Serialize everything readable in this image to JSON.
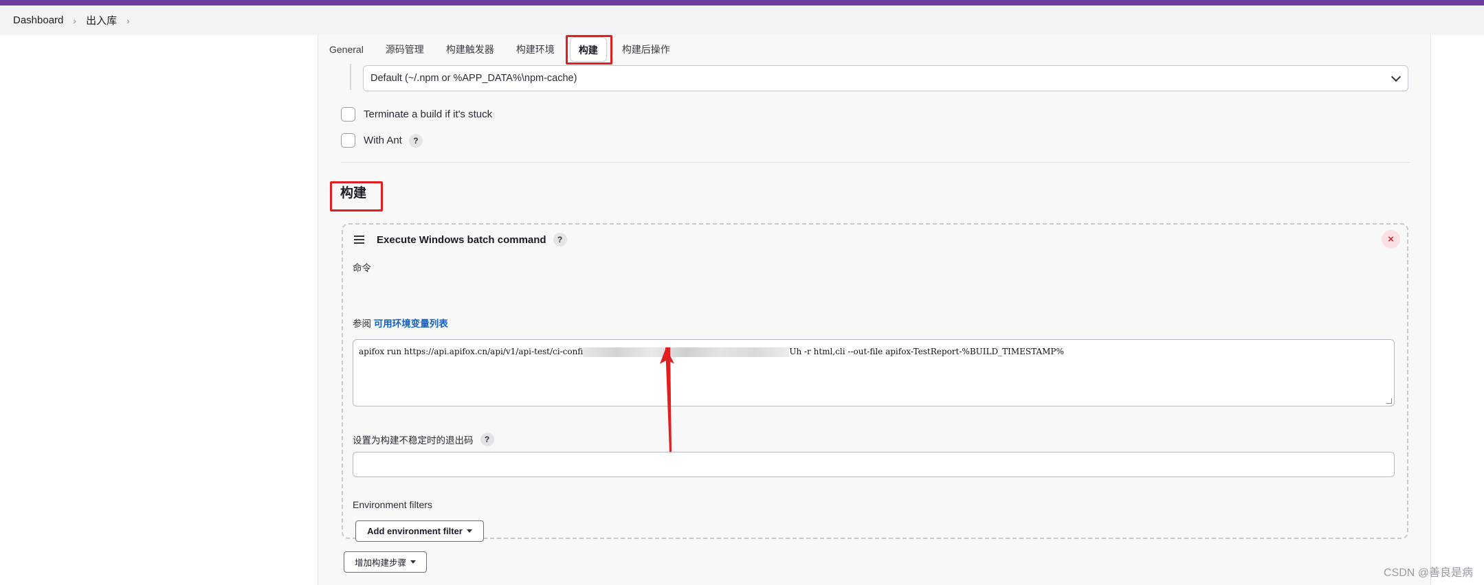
{
  "breadcrumb": {
    "items": [
      "Dashboard",
      "出入库"
    ]
  },
  "tabs": [
    "General",
    "源码管理",
    "构建触发器",
    "构建环境",
    "构建",
    "构建后操作"
  ],
  "active_tab": "构建",
  "npm_cache_select": {
    "value": "Default (~/.npm or %APP_DATA%\\npm-cache)"
  },
  "checkboxes": {
    "terminate_label": "Terminate a build if it's stuck",
    "with_ant_label": "With Ant"
  },
  "section": {
    "title": "构建"
  },
  "build_step": {
    "title": "Execute Windows batch command",
    "help": "?",
    "close": "×",
    "command_label": "命令",
    "see_also_prefix": "参阅",
    "see_also_link": "可用环境变量列表",
    "command_start": "apifox run https://api.apifox.cn/api/v1/api-test/ci-confi",
    "command_end": "Uh -r html,cli --out-file apifox-TestReport-%BUILD_TIMESTAMP%",
    "exit_code_label": "设置为构建不稳定时的退出码",
    "env_filters_label": "Environment filters",
    "add_env_filter": "Add environment filter"
  },
  "add_build_step": "增加构建步骤",
  "watermark": "CSDN @善良是病",
  "colors": {
    "top_bar": "#6b3fa0",
    "highlight": "#e02020",
    "link": "#1560bd"
  }
}
